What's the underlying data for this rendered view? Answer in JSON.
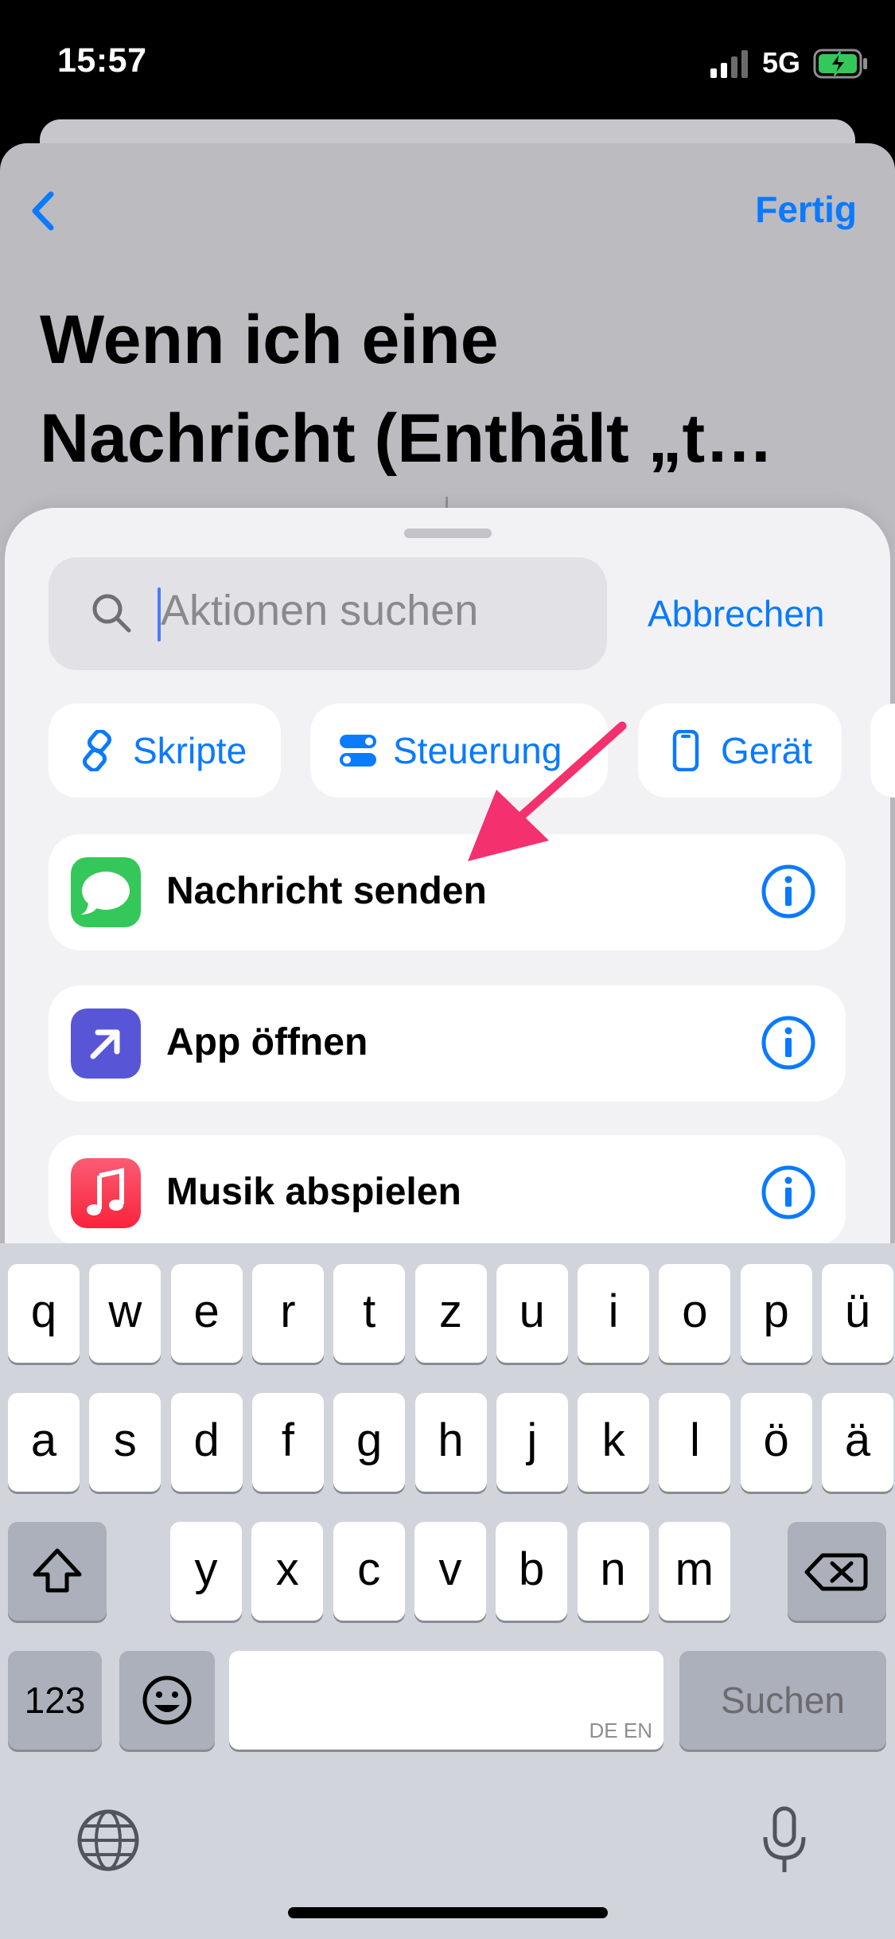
{
  "status": {
    "time": "15:57",
    "network": "5G"
  },
  "header": {
    "done_label": "Fertig",
    "title_line1": "Wenn ich eine",
    "title_line2": "Nachricht (Enthält „t…"
  },
  "search": {
    "placeholder": "Aktionen suchen",
    "cancel_label": "Abbrechen"
  },
  "categories": [
    {
      "label": "Skripte",
      "icon": "scripts-icon"
    },
    {
      "label": "Steuerung",
      "icon": "controls-icon"
    },
    {
      "label": "Gerät",
      "icon": "phone-icon"
    }
  ],
  "actions": [
    {
      "label": "Nachricht senden",
      "icon": "messages-icon",
      "color": "#34c759"
    },
    {
      "label": "App öffnen",
      "icon": "open-app-icon",
      "color": "#5856d6"
    },
    {
      "label": "Musik abspielen",
      "icon": "music-icon",
      "color": "#fa2d48"
    }
  ],
  "annotation": {
    "arrow_color": "#f4306e"
  },
  "keyboard": {
    "row1": [
      "q",
      "w",
      "e",
      "r",
      "t",
      "z",
      "u",
      "i",
      "o",
      "p",
      "ü"
    ],
    "row2": [
      "a",
      "s",
      "d",
      "f",
      "g",
      "h",
      "j",
      "k",
      "l",
      "ö",
      "ä"
    ],
    "row3": [
      "y",
      "x",
      "c",
      "v",
      "b",
      "n",
      "m"
    ],
    "numbers_label": "123",
    "space_hint": "DE EN",
    "search_label": "Suchen"
  },
  "accent_color": "#0a7aff"
}
